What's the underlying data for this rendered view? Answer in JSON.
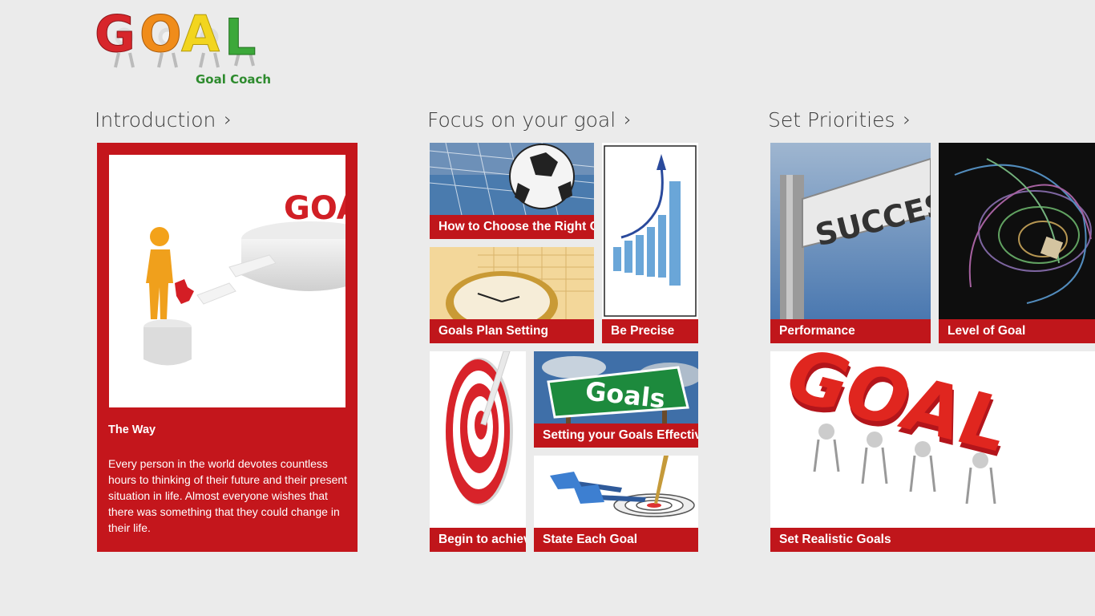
{
  "app": {
    "logo_text": "GOAL",
    "subtitle": "Goal Coach"
  },
  "sections": [
    {
      "title": "Introduction",
      "chevron": "›"
    },
    {
      "title": "Focus on your goal",
      "chevron": "›"
    },
    {
      "title": "Set Priorities",
      "chevron": "›"
    }
  ],
  "intro": {
    "title": "The Way",
    "body": "Every person in the world devotes countless hours to thinking of their future and their present situation in life. Almost everyone wishes that there was something  that they could change in their life."
  },
  "focus": {
    "tiles": [
      {
        "label": "How to Choose the Right Goal"
      },
      {
        "label": "Be Precise"
      },
      {
        "label": "Goals Plan Setting"
      },
      {
        "label": "Begin to achieve"
      },
      {
        "label": "Setting your Goals Effectively"
      },
      {
        "label": "State Each Goal"
      }
    ],
    "goals_sign_text": "Goals"
  },
  "priorities": {
    "tiles": [
      {
        "label": "Performance"
      },
      {
        "label": "Level of Goal"
      },
      {
        "label": "Set Realistic Goals"
      }
    ],
    "success_sign_text": "SUCCESS",
    "goal_3d_text": "GOAL",
    "goa_text": "GOA"
  },
  "colors": {
    "background": "#ebebeb",
    "accent_red": "#c4161c"
  }
}
